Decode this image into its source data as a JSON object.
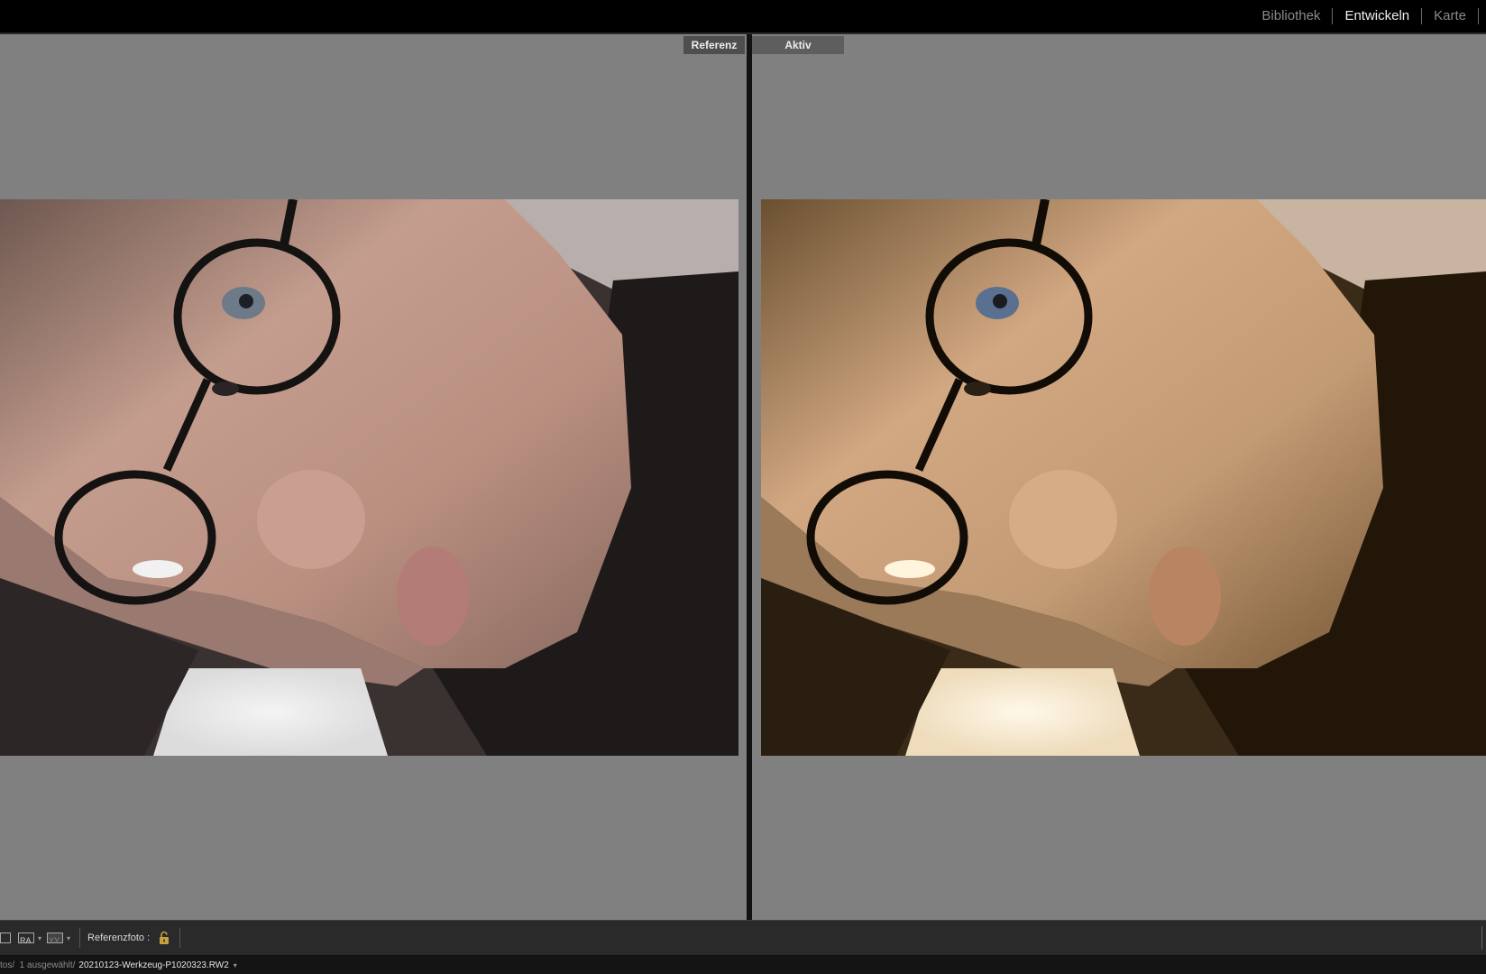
{
  "modules": [
    {
      "label": "Bibliothek",
      "active": false
    },
    {
      "label": "Entwickeln",
      "active": true
    },
    {
      "label": "Karte",
      "active": false
    }
  ],
  "panes": {
    "reference_label": "Referenz",
    "active_label": "Aktiv"
  },
  "toolbar": {
    "view_icons": [
      "loupe-view-icon",
      "reference-view-icon",
      "before-after-icon"
    ],
    "reference_photo_label": "Referenzfoto :",
    "lock_icon": "lock-icon"
  },
  "pathbar": {
    "prefix": "tos/  1 ausgewählt/",
    "filename": "20210123-Werkzeug-P1020323.RW2"
  },
  "colors": {
    "background_gray": "#808080",
    "chrome_black": "#000000",
    "toolbar": "#2a2a2a",
    "active_module": "#f0f0f0",
    "inactive_module": "#8a8a8a"
  }
}
